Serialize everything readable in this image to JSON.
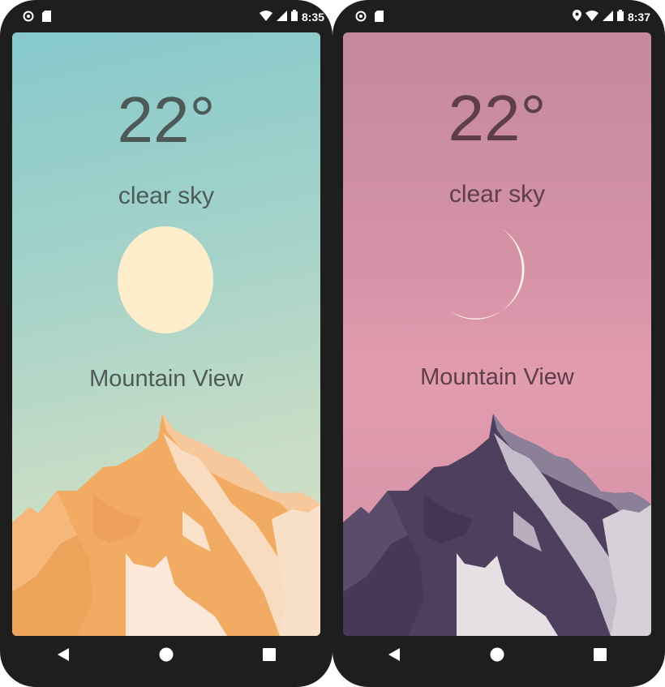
{
  "screens": [
    {
      "theme": "day",
      "status": {
        "time": "8:35"
      },
      "temperature": "22°",
      "description": "clear sky",
      "city": "Mountain View",
      "icon": "sun-icon",
      "colors": {
        "sky_top": "#86c9cc",
        "sky_bottom": "#dce6c4",
        "mountain": "#f0a860",
        "text": "#4e5a57"
      }
    },
    {
      "theme": "night",
      "status": {
        "time": "8:37"
      },
      "temperature": "22°",
      "description": "clear sky",
      "city": "Mountain View",
      "icon": "moon-icon",
      "colors": {
        "sky_top": "#c4899c",
        "sky_bottom": "#e29cb0",
        "mountain": "#4e3f5e",
        "text": "#5e3e48"
      }
    }
  ],
  "nav": {
    "back_icon": "back-triangle-icon",
    "home_icon": "home-circle-icon",
    "recents_icon": "recents-square-icon"
  }
}
